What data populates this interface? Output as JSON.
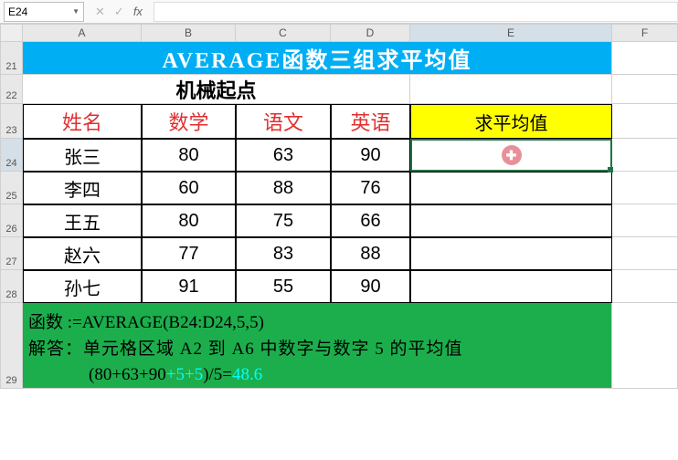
{
  "name_box": "E24",
  "fx_cancel": "✕",
  "fx_confirm": "✓",
  "fx_label": "fx",
  "columns": [
    "",
    "A",
    "B",
    "C",
    "D",
    "E",
    "F"
  ],
  "row_numbers": [
    "21",
    "22",
    "23",
    "24",
    "25",
    "26",
    "27",
    "28",
    "29"
  ],
  "title": "AVERAGE函数三组求平均值",
  "subtitle": "机械起点",
  "headers": {
    "name": "姓名",
    "math": "数学",
    "chinese": "语文",
    "english": "英语",
    "avg": "求平均值"
  },
  "rows": [
    {
      "name": "张三",
      "math": "80",
      "chinese": "63",
      "english": "90"
    },
    {
      "name": "李四",
      "math": "60",
      "chinese": "88",
      "english": "76"
    },
    {
      "name": "王五",
      "math": "80",
      "chinese": "75",
      "english": "66"
    },
    {
      "name": "赵六",
      "math": "77",
      "chinese": "83",
      "english": "88"
    },
    {
      "name": "孙七",
      "math": "91",
      "chinese": "55",
      "english": "90"
    }
  ],
  "footer": {
    "l1a": "函数 :=AVERAGE(B24:D24,5,5)",
    "l2a": "解答：单元格区域 A2 到 A6 中数字与数字 5 的平均值",
    "l3a": "(80+63+90",
    "l3b": "+5+5",
    "l3c": ")/5=",
    "l3d": "48.6"
  },
  "cursor_glyph": "✚",
  "chart_data": {
    "type": "table",
    "title": "AVERAGE函数三组求平均值",
    "columns": [
      "姓名",
      "数学",
      "语文",
      "英语",
      "求平均值"
    ],
    "rows": [
      [
        "张三",
        80,
        63,
        90,
        null
      ],
      [
        "李四",
        60,
        88,
        76,
        null
      ],
      [
        "王五",
        80,
        75,
        66,
        null
      ],
      [
        "赵六",
        77,
        83,
        88,
        null
      ],
      [
        "孙七",
        91,
        55,
        90,
        null
      ]
    ],
    "formula": "=AVERAGE(B24:D24,5,5)",
    "explanation": "单元格区域 A2 到 A6 中数字与数字 5 的平均值 (80+63+90+5+5)/5=48.6",
    "result": 48.6
  }
}
